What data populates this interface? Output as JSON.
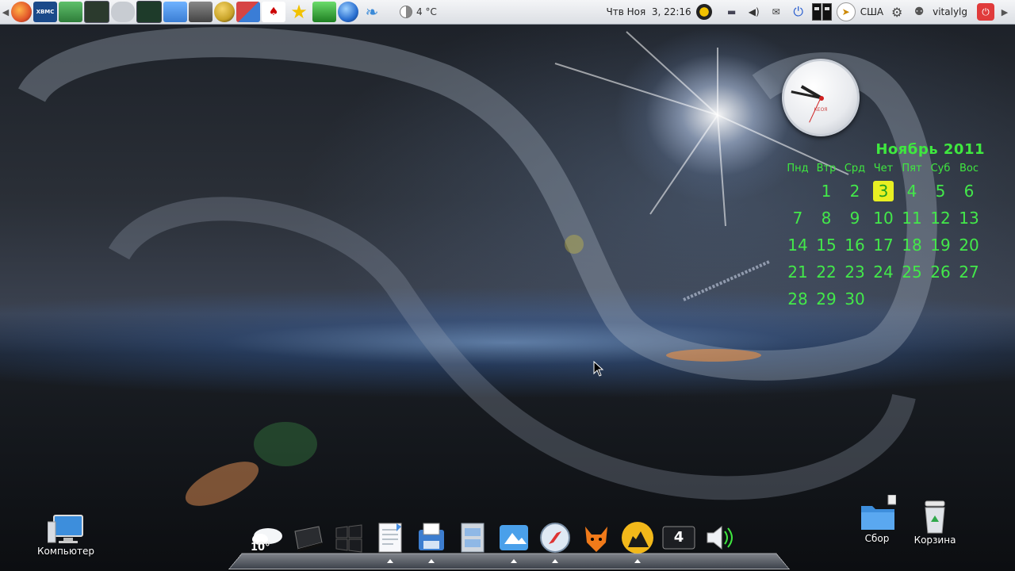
{
  "top_panel": {
    "launchers": [
      {
        "name": "firefox-icon",
        "color": "#e2552a"
      },
      {
        "name": "xbmc-icon",
        "color": "#1b4a8a",
        "label": "XBMC"
      },
      {
        "name": "network-info-icon",
        "color": "#2f7d3a"
      },
      {
        "name": "system-monitor-icon",
        "color": "#2b3a2d"
      },
      {
        "name": "gamepad-icon",
        "color": "#9aa0a8"
      },
      {
        "name": "terminal-monitor-icon",
        "color": "#1e3b2a"
      },
      {
        "name": "image-viewer-icon",
        "color": "#3b7ed4"
      },
      {
        "name": "disk-drive-icon",
        "color": "#5a5f66"
      },
      {
        "name": "game-ball-icon",
        "color": "#c7a227"
      },
      {
        "name": "shapes-game-icon",
        "color": "#d64545"
      },
      {
        "name": "cards-icon",
        "color": "#ffffff"
      },
      {
        "name": "star-icon",
        "color": "#f2c200"
      },
      {
        "name": "battery-icon",
        "color": "#38a83a"
      },
      {
        "name": "globe-icon",
        "color": "#2a6fd0"
      },
      {
        "name": "fish-icon",
        "color": "#3a8ad8"
      }
    ],
    "weather": {
      "temp": "4 °C"
    },
    "datetime": "Чтв Ноя  3, 22:16",
    "keyboard_layout": "США",
    "username": "vitalylg"
  },
  "clock_widget": {
    "brand": "КЕОЯ",
    "hour_angle": -150,
    "minute_angle": -168,
    "second_angle": 115
  },
  "calendar": {
    "title": "Ноябрь 2011",
    "weekdays": [
      "Пнд",
      "Втр",
      "Срд",
      "Чет",
      "Пят",
      "Суб",
      "Вос"
    ],
    "leading_blanks": 1,
    "days": [
      "1",
      "2",
      "3",
      "4",
      "5",
      "6",
      "7",
      "8",
      "9",
      "10",
      "11",
      "12",
      "13",
      "14",
      "15",
      "16",
      "17",
      "18",
      "19",
      "20",
      "21",
      "22",
      "23",
      "24",
      "25",
      "26",
      "27",
      "28",
      "29",
      "30"
    ],
    "today": "3"
  },
  "desktop": {
    "computer_label": "Компьютер",
    "collect_label": "Сбор",
    "trash_label": "Корзина"
  },
  "dock": {
    "weather_temp": "10°",
    "workspace_number": "4",
    "items": [
      {
        "name": "weather-cloud-icon",
        "active": false
      },
      {
        "name": "hard-drive-icon",
        "active": false
      },
      {
        "name": "windows-logo-icon",
        "active": false
      },
      {
        "name": "text-document-icon",
        "active": true
      },
      {
        "name": "save-floppy-icon",
        "active": true
      },
      {
        "name": "file-cabinet-icon",
        "active": false
      },
      {
        "name": "image-editor-icon",
        "active": true
      },
      {
        "name": "safari-compass-icon",
        "active": true
      },
      {
        "name": "fox-mascot-icon",
        "active": false
      },
      {
        "name": "moon-wolf-icon",
        "active": true
      },
      {
        "name": "workspace-switcher-icon",
        "active": false
      },
      {
        "name": "volume-icon",
        "active": false
      }
    ]
  }
}
